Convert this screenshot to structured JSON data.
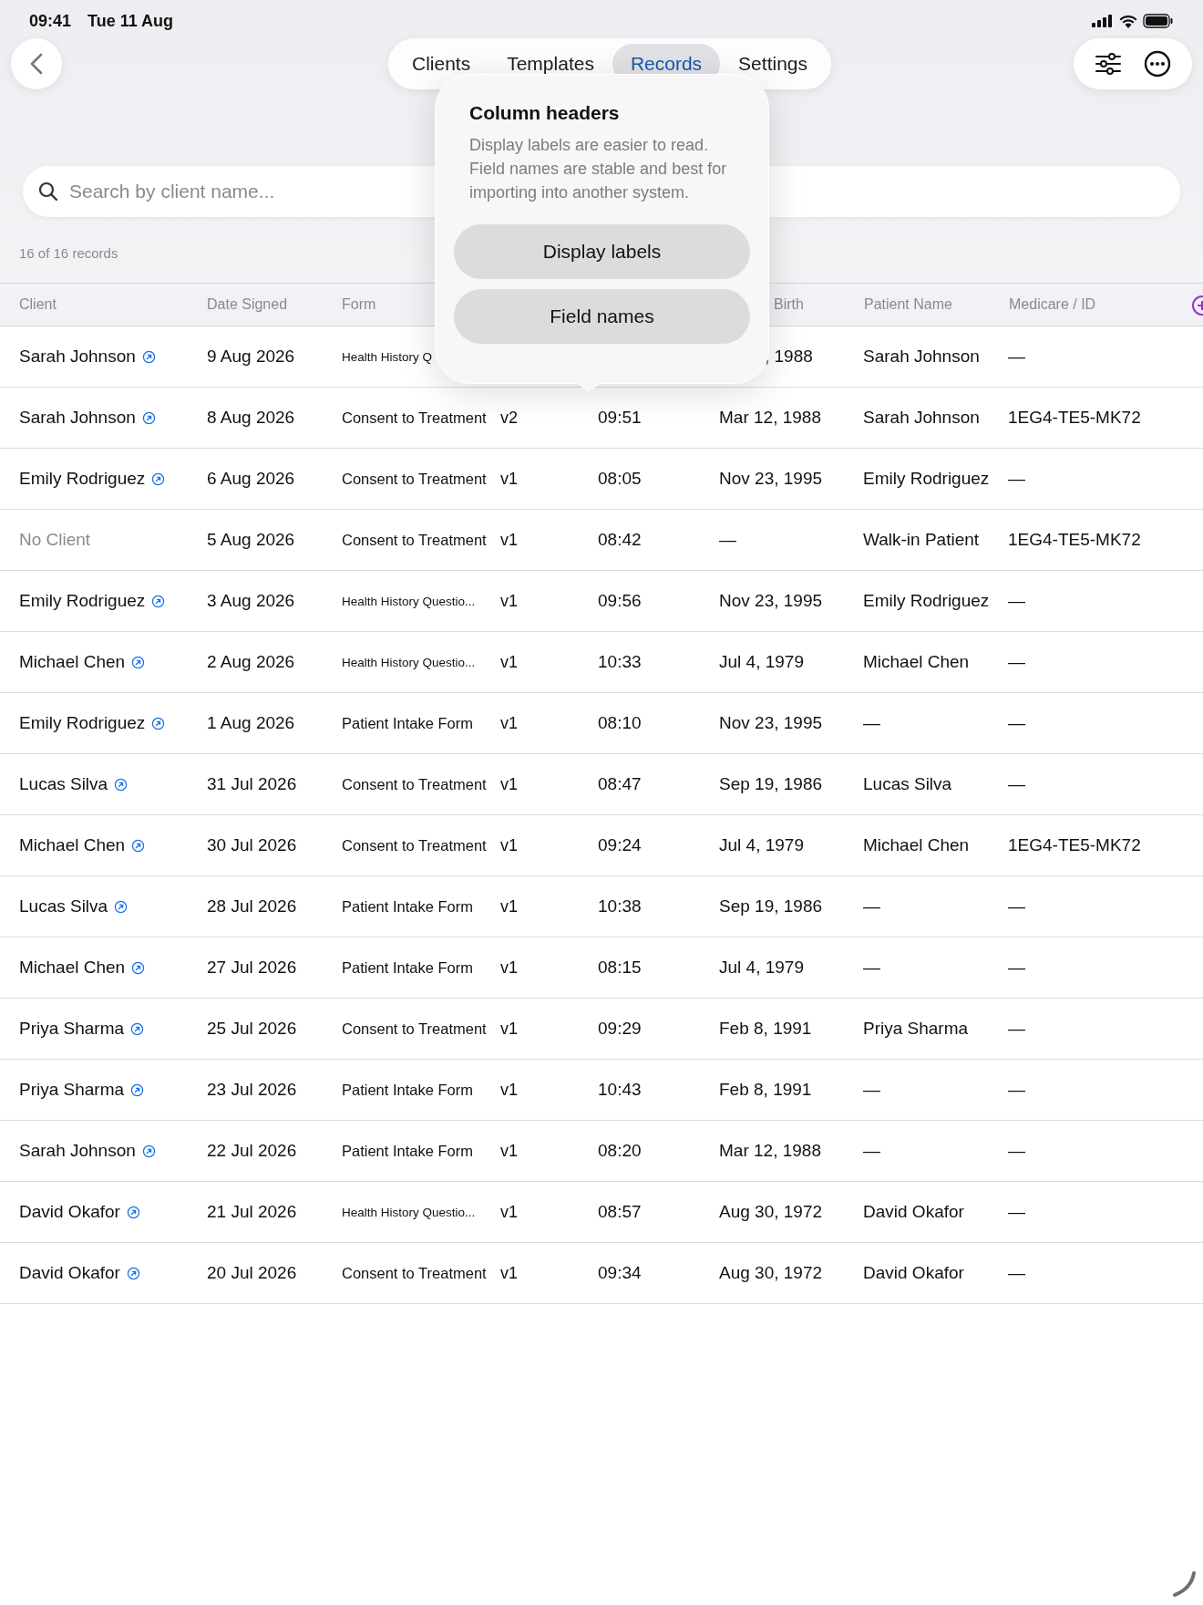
{
  "status_bar": {
    "time": "09:41",
    "date": "Tue 11 Aug"
  },
  "tabs": [
    {
      "label": "Clients",
      "selected": false
    },
    {
      "label": "Templates",
      "selected": false
    },
    {
      "label": "Records",
      "selected": true
    },
    {
      "label": "Settings",
      "selected": false
    }
  ],
  "search": {
    "placeholder": "Search by client name..."
  },
  "record_count": "16 of 16 records",
  "columns": [
    {
      "label": "Client"
    },
    {
      "label": "Date Signed"
    },
    {
      "label": "Form"
    },
    {
      "label": "Birth",
      "partial": true
    },
    {
      "label": "Patient Name"
    },
    {
      "label": "Medicare / ID"
    }
  ],
  "rows": [
    {
      "client": "Sarah Johnson",
      "linked": true,
      "date": "9 Aug 2026",
      "form": "Health History Q",
      "compact": true,
      "dob": ", 1988",
      "dob_partial": true,
      "patient": "Sarah Johnson",
      "medicare": "—"
    },
    {
      "client": "Sarah Johnson",
      "linked": true,
      "date": "8 Aug 2026",
      "form": "Consent to Treatment",
      "compact": false,
      "version": "v2",
      "time": "09:51",
      "dob": "Mar 12, 1988",
      "patient": "Sarah Johnson",
      "medicare": "1EG4-TE5-MK72"
    },
    {
      "client": "Emily Rodriguez",
      "linked": true,
      "date": "6 Aug 2026",
      "form": "Consent to Treatment",
      "compact": false,
      "version": "v1",
      "time": "08:05",
      "dob": "Nov 23, 1995",
      "patient": "Emily Rodriguez",
      "medicare": "—"
    },
    {
      "client": "No Client",
      "linked": false,
      "date": "5 Aug 2026",
      "form": "Consent to Treatment",
      "compact": false,
      "version": "v1",
      "time": "08:42",
      "dob": "—",
      "patient": "Walk-in Patient",
      "medicare": "1EG4-TE5-MK72"
    },
    {
      "client": "Emily Rodriguez",
      "linked": true,
      "date": "3 Aug 2026",
      "form": "Health History Questio...",
      "compact": true,
      "version": "v1",
      "time": "09:56",
      "dob": "Nov 23, 1995",
      "patient": "Emily Rodriguez",
      "medicare": "—"
    },
    {
      "client": "Michael Chen",
      "linked": true,
      "date": "2 Aug 2026",
      "form": "Health History Questio...",
      "compact": true,
      "version": "v1",
      "time": "10:33",
      "dob": "Jul 4, 1979",
      "patient": "Michael Chen",
      "medicare": "—"
    },
    {
      "client": "Emily Rodriguez",
      "linked": true,
      "date": "1 Aug 2026",
      "form": "Patient Intake Form",
      "compact": false,
      "version": "v1",
      "time": "08:10",
      "dob": "Nov 23, 1995",
      "patient": "—",
      "medicare": "—"
    },
    {
      "client": "Lucas Silva",
      "linked": true,
      "date": "31 Jul 2026",
      "form": "Consent to Treatment",
      "compact": false,
      "version": "v1",
      "time": "08:47",
      "dob": "Sep 19, 1986",
      "patient": "Lucas Silva",
      "medicare": "—"
    },
    {
      "client": "Michael Chen",
      "linked": true,
      "date": "30 Jul 2026",
      "form": "Consent to Treatment",
      "compact": false,
      "version": "v1",
      "time": "09:24",
      "dob": "Jul 4, 1979",
      "patient": "Michael Chen",
      "medicare": "1EG4-TE5-MK72"
    },
    {
      "client": "Lucas Silva",
      "linked": true,
      "date": "28 Jul 2026",
      "form": "Patient Intake Form",
      "compact": false,
      "version": "v1",
      "time": "10:38",
      "dob": "Sep 19, 1986",
      "patient": "—",
      "medicare": "—"
    },
    {
      "client": "Michael Chen",
      "linked": true,
      "date": "27 Jul 2026",
      "form": "Patient Intake Form",
      "compact": false,
      "version": "v1",
      "time": "08:15",
      "dob": "Jul 4, 1979",
      "patient": "—",
      "medicare": "—"
    },
    {
      "client": "Priya Sharma",
      "linked": true,
      "date": "25 Jul 2026",
      "form": "Consent to Treatment",
      "compact": false,
      "version": "v1",
      "time": "09:29",
      "dob": "Feb 8, 1991",
      "patient": "Priya Sharma",
      "medicare": "—"
    },
    {
      "client": "Priya Sharma",
      "linked": true,
      "date": "23 Jul 2026",
      "form": "Patient Intake Form",
      "compact": false,
      "version": "v1",
      "time": "10:43",
      "dob": "Feb 8, 1991",
      "patient": "—",
      "medicare": "—"
    },
    {
      "client": "Sarah Johnson",
      "linked": true,
      "date": "22 Jul 2026",
      "form": "Patient Intake Form",
      "compact": false,
      "version": "v1",
      "time": "08:20",
      "dob": "Mar 12, 1988",
      "patient": "—",
      "medicare": "—"
    },
    {
      "client": "David Okafor",
      "linked": true,
      "date": "21 Jul 2026",
      "form": "Health History Questio...",
      "compact": true,
      "version": "v1",
      "time": "08:57",
      "dob": "Aug 30, 1972",
      "patient": "David Okafor",
      "medicare": "—"
    },
    {
      "client": "David Okafor",
      "linked": true,
      "date": "20 Jul 2026",
      "form": "Consent to Treatment",
      "compact": false,
      "version": "v1",
      "time": "09:34",
      "dob": "Aug 30, 1972",
      "patient": "David Okafor",
      "medicare": "—"
    }
  ],
  "popover": {
    "title": "Column headers",
    "body": "Display labels are easier to read. Field names are stable and best for importing into another system.",
    "buttons": [
      "Display labels",
      "Field names"
    ]
  }
}
